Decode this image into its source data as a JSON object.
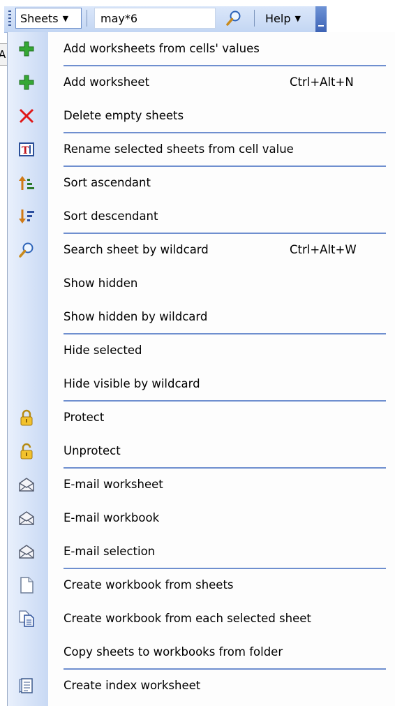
{
  "toolbar": {
    "sheets_label": "Sheets",
    "search_value": "may*6",
    "help_label": "Help"
  },
  "behind_text": "A",
  "menu": {
    "items": [
      {
        "label": "Add worksheets from cells' values",
        "icon": "green-plus-icon",
        "shortcut": ""
      },
      {
        "label": "Add worksheet",
        "icon": "green-plus-icon",
        "shortcut": "Ctrl+Alt+N"
      },
      {
        "label": "Delete empty sheets",
        "icon": "red-x-icon",
        "shortcut": ""
      },
      {
        "label": "Rename selected sheets from cell value",
        "icon": "rename-icon",
        "shortcut": ""
      },
      {
        "label": "Sort ascendant",
        "icon": "sort-ascending-icon",
        "shortcut": ""
      },
      {
        "label": "Sort descendant",
        "icon": "sort-descending-icon",
        "shortcut": ""
      },
      {
        "label": "Search sheet by wildcard",
        "icon": "magnifier-icon",
        "shortcut": "Ctrl+Alt+W"
      },
      {
        "label": "Show hidden",
        "icon": "",
        "shortcut": ""
      },
      {
        "label": "Show hidden by wildcard",
        "icon": "",
        "shortcut": ""
      },
      {
        "label": "Hide selected",
        "icon": "",
        "shortcut": ""
      },
      {
        "label": "Hide visible by wildcard",
        "icon": "",
        "shortcut": ""
      },
      {
        "label": "Protect",
        "icon": "lock-icon",
        "shortcut": ""
      },
      {
        "label": "Unprotect",
        "icon": "unlock-icon",
        "shortcut": ""
      },
      {
        "label": "E-mail worksheet",
        "icon": "envelope-icon",
        "shortcut": ""
      },
      {
        "label": "E-mail workbook",
        "icon": "envelope-icon",
        "shortcut": ""
      },
      {
        "label": "E-mail selection",
        "icon": "envelope-icon",
        "shortcut": ""
      },
      {
        "label": "Create workbook from sheets",
        "icon": "blank-page-icon",
        "shortcut": ""
      },
      {
        "label": "Create workbook from each selected sheet",
        "icon": "copy-pages-icon",
        "shortcut": ""
      },
      {
        "label": "Copy sheets to workbooks from folder",
        "icon": "",
        "shortcut": ""
      },
      {
        "label": "Create index worksheet",
        "icon": "index-sheet-icon",
        "shortcut": ""
      }
    ]
  },
  "colors": {
    "toolbar_bg": "#c3d6f3",
    "menu_gutter": "#c8d9f4",
    "separator": "#6f8fcf",
    "plus_green": "#2e9e2e",
    "delete_red": "#e01818"
  }
}
